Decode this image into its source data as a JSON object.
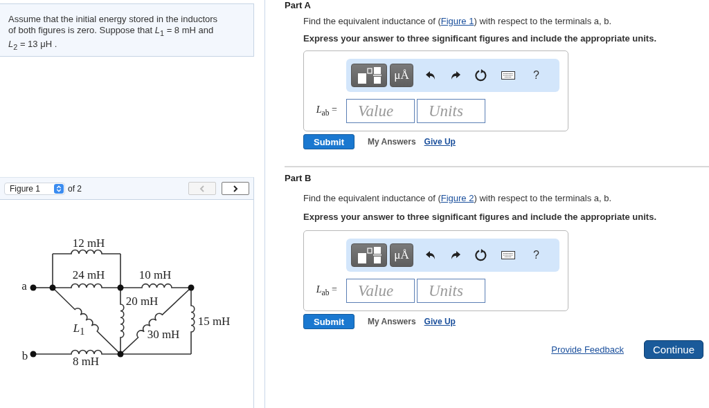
{
  "problem": {
    "text": "Assume that the initial energy stored in the inductors of both figures is zero. Suppose that *L*$_{1}$ = 8  mH and *L*$_{2}$ = 13  μH ."
  },
  "figure_viewer": {
    "selector": "Figure 1",
    "count": "of 2",
    "prev": {
      "disabled": true
    },
    "next": {
      "disabled": false
    }
  },
  "circuit": {
    "terminals": [
      "a",
      "b"
    ],
    "labels": [
      "12 mH",
      "24 mH",
      "10 mH",
      "20 mH",
      "15 mH",
      "30 mH",
      "*L*$_{1}$",
      "8 mH"
    ]
  },
  "parts": [
    {
      "title": "Part A",
      "prompt_before": "Find the equivalent inductance of (",
      "link": "Figure 1",
      "prompt_after": ") with respect to the terminals a, b.",
      "instruction": "Express your answer to three significant figures and include the appropriate units.",
      "units_button": "μÅ",
      "help": "?",
      "variable": "*L*$_{ab}$ =",
      "value_placeholder": "Value",
      "units_placeholder": "Units",
      "submit": "Submit",
      "my_answers": "My Answers",
      "give_up": "Give Up"
    },
    {
      "title": "Part B",
      "prompt_before": "Find the equivalent inductance of (",
      "link": "Figure 2",
      "prompt_after": ") with respect to the terminals a, b.",
      "instruction": "Express your answer to three significant figures and include the appropriate units.",
      "units_button": "μÅ",
      "help": "?",
      "variable": "*L*$_{ab}$ =",
      "value_placeholder": "Value",
      "units_placeholder": "Units",
      "submit": "Submit",
      "my_answers": "My Answers",
      "give_up": "Give Up"
    }
  ],
  "footer": {
    "feedback": "Provide Feedback",
    "continue": "Continue"
  }
}
